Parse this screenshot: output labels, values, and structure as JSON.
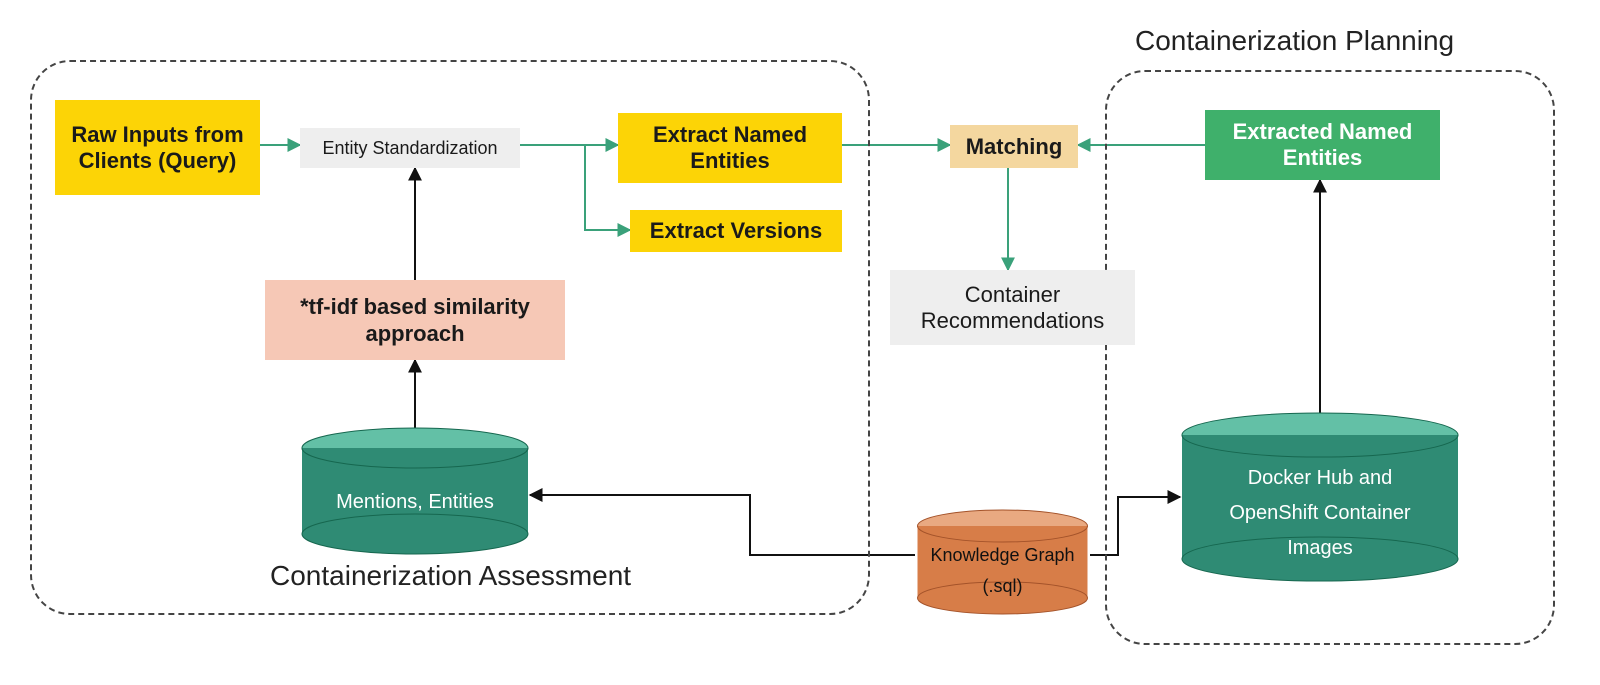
{
  "groups": {
    "assessment": {
      "title": "Containerization Assessment"
    },
    "planning": {
      "title": "Containerization Planning"
    }
  },
  "nodes": {
    "raw_inputs": {
      "label": "Raw Inputs from Clients (Query)"
    },
    "entity_std": {
      "label": "Entity  Standardization"
    },
    "extract_named": {
      "label": "Extract Named Entities"
    },
    "extract_versions": {
      "label": "Extract Versions"
    },
    "tfidf": {
      "label": "*tf-idf based similarity approach"
    },
    "mentions_db": {
      "label": "Mentions, Entities"
    },
    "matching": {
      "label": "Matching"
    },
    "container_recs": {
      "label": "Container Recommendations"
    },
    "extracted_named": {
      "label": "Extracted Named Entities"
    },
    "docker_db": {
      "line1": "Docker Hub and",
      "line2": "OpenShift Container",
      "line3": "Images"
    },
    "kg_db": {
      "line1": "Knowledge Graph",
      "line2": "(.sql)"
    }
  },
  "colors": {
    "yellow": "#fcd406",
    "grey_box": "#eeeeee",
    "peach": "#f6c8b6",
    "tan": "#f4d79f",
    "green_box": "#3fb06b",
    "teal_top": "#63c0a6",
    "teal_side": "#2f8b74",
    "orange_top": "#e9a981",
    "orange_side": "#d77d48",
    "arrow_green": "#3aa17a",
    "arrow_black": "#111111"
  }
}
